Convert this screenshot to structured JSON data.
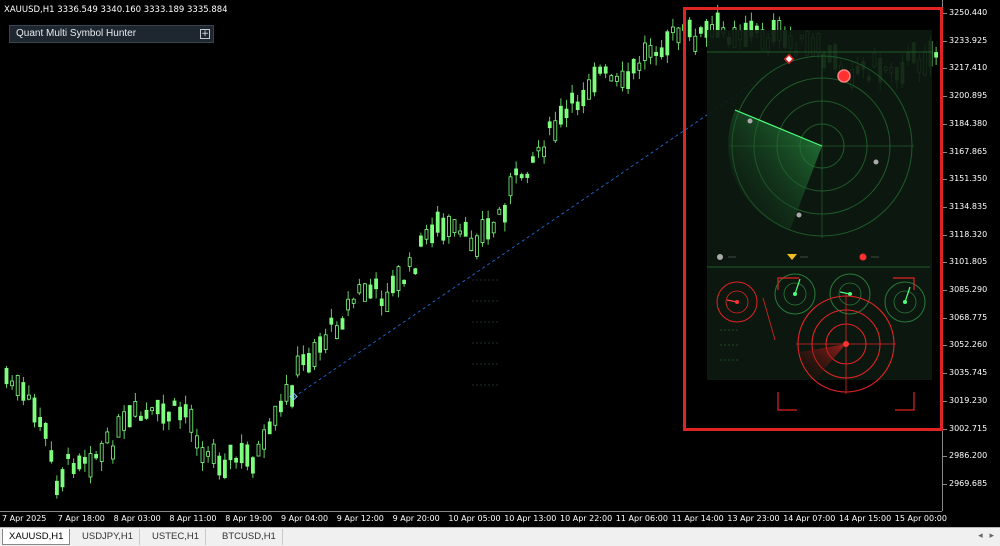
{
  "symbol_info": "XAUUSD,H1  3336.549 3340.160 3333.189 3335.884",
  "panel": {
    "title": "Quant Multi Symbol Hunter",
    "toggle": "+"
  },
  "price_scale": [
    "3250.440",
    "3233.925",
    "3217.410",
    "3200.895",
    "3184.380",
    "3167.865",
    "3151.350",
    "3134.835",
    "3118.320",
    "3101.805",
    "3085.290",
    "3068.775",
    "3052.260",
    "3035.745",
    "3019.230",
    "3002.715",
    "2986.200",
    "2969.685"
  ],
  "time_axis": [
    "7 Apr 2025",
    "7 Apr 18:00",
    "8 Apr 03:00",
    "8 Apr 11:00",
    "8 Apr 19:00",
    "9 Apr 04:00",
    "9 Apr 12:00",
    "9 Apr 20:00",
    "10 Apr 05:00",
    "10 Apr 13:00",
    "10 Apr 22:00",
    "11 Apr 06:00",
    "11 Apr 14:00",
    "13 Apr 23:00",
    "14 Apr 07:00",
    "14 Apr 15:00",
    "15 Apr 00:00"
  ],
  "tabs": [
    "XAUUSD,H1",
    "USDJPY,H1",
    "USTEC,H1",
    "BTCUSD,H1"
  ],
  "active_tab": 0,
  "colors": {
    "bull_candle": "#7dff7d",
    "bear_candle": "#7dff7d",
    "radar_green": "#1f7a3a",
    "radar_red": "#e02424",
    "frame": "#e02424",
    "trend_line": "#1e6ad8"
  },
  "icons": {
    "panel_toggle": "plus-icon",
    "tab_scroll": "tab-scroll-arrows-icon"
  },
  "tab_scroll_glyph": "◂ ▸"
}
